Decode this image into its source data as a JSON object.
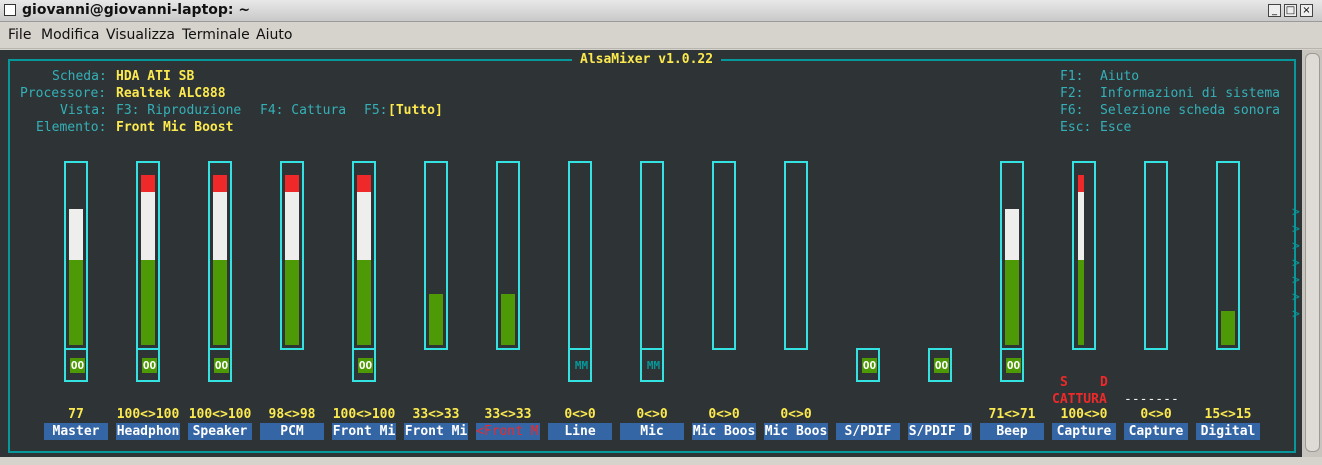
{
  "window": {
    "title": "giovanni@giovanni-laptop: ~",
    "buttons": [
      "_",
      "□",
      "×"
    ]
  },
  "menubar": [
    "File",
    "Modifica",
    "Visualizza",
    "Terminale",
    "Aiuto"
  ],
  "mixer": {
    "title": "AlsaMixer v1.0.22",
    "info": {
      "card_label": "Scheda:",
      "card": "HDA ATI SB",
      "chip_label": "Processore:",
      "chip": "Realtek ALC888",
      "view_label": "Vista:",
      "view_f3": "F3: Riproduzione",
      "view_f4": "F4: Cattura",
      "view_f5": "F5:",
      "view_selected": "[Tutto]",
      "item_label": "Elemento:",
      "item": "Front Mic Boost"
    },
    "help": [
      {
        "key": "F1:",
        "text": "Aiuto"
      },
      {
        "key": "F2:",
        "text": "Informazioni di sistema"
      },
      {
        "key": "F6:",
        "text": "Selezione scheda sonora"
      },
      {
        "key": "Esc:",
        "text": "Esce"
      }
    ],
    "capture_labels": {
      "left": "S",
      "right": "D",
      "title": "CATTURA",
      "dashes": "-------"
    },
    "right_arrows": [
      ">",
      ">",
      ">",
      ">",
      ">",
      ">",
      ">"
    ],
    "channels": [
      {
        "name": "Master",
        "value": "77",
        "level": 0.77,
        "switch": "OO",
        "switch_state": "on"
      },
      {
        "name": "Headphon",
        "value": "100<>100",
        "level": 1.0,
        "switch": "OO",
        "switch_state": "on"
      },
      {
        "name": "Speaker",
        "value": "100<>100",
        "level": 1.0,
        "switch": "OO",
        "switch_state": "on"
      },
      {
        "name": "PCM",
        "value": "98<>98",
        "level": 1.0
      },
      {
        "name": "Front Mi",
        "value": "100<>100",
        "level": 1.0,
        "switch": "OO",
        "switch_state": "on"
      },
      {
        "name": "Front Mi",
        "value": "33<>33",
        "level": 0.33
      },
      {
        "name": "<Front Mi>",
        "value": "33<>33",
        "level": 0.33,
        "selected": true
      },
      {
        "name": "Line",
        "value": "0<>0",
        "level": 0,
        "switch": "MM",
        "switch_state": "mute"
      },
      {
        "name": "Mic",
        "value": "0<>0",
        "level": 0,
        "switch": "MM",
        "switch_state": "mute"
      },
      {
        "name": "Mic Boos",
        "value": "0<>0",
        "level": 0
      },
      {
        "name": "Mic Boos",
        "value": "0<>0",
        "level": 0
      },
      {
        "name": "S/PDIF",
        "switch": "OO",
        "switch_state": "on",
        "no_bar": true
      },
      {
        "name": "S/PDIF D",
        "switch": "OO",
        "switch_state": "on",
        "no_bar": true
      },
      {
        "name": "Beep",
        "value": "71<>71",
        "level": 0.77,
        "switch": "OO",
        "switch_state": "on"
      },
      {
        "name": "Capture",
        "value": "100<>0",
        "level": 1.0,
        "capture": true,
        "narrow": true
      },
      {
        "name": "Capture",
        "value": "0<>0",
        "level": 0
      },
      {
        "name": "Digital",
        "value": "15<>15",
        "level": 0.2
      }
    ],
    "colors": {
      "background": "#2e3436",
      "frame": "#06989a",
      "label": "#34b0b8",
      "value": "#fce94f",
      "bar_low": "#4e9a06",
      "bar_mid": "#eeeeec",
      "bar_high": "#ef2929",
      "name_bg": "#3465a4"
    }
  }
}
